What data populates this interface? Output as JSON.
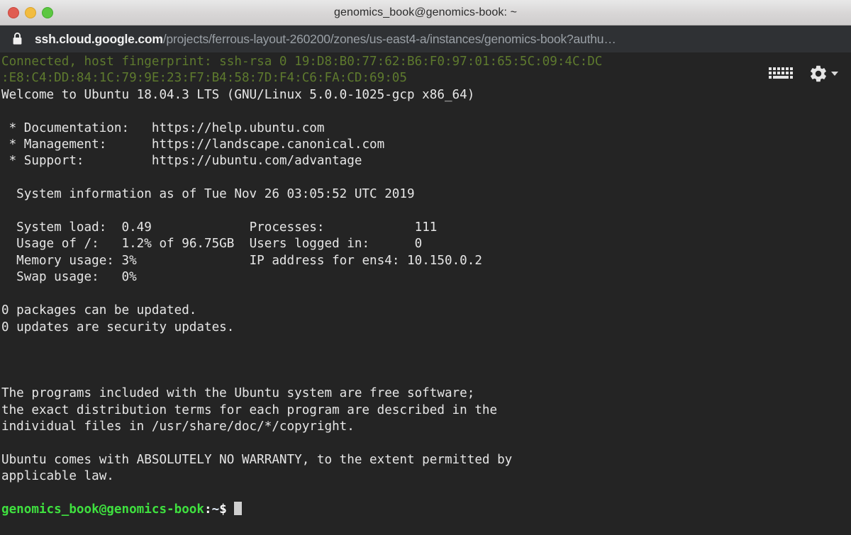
{
  "window": {
    "title": "genomics_book@genomics-book: ~",
    "controls": [
      {
        "name": "close",
        "color": "#e05c51"
      },
      {
        "name": "minimize",
        "color": "#f2bc3f"
      },
      {
        "name": "maximize",
        "color": "#5cc741"
      }
    ]
  },
  "urlbar": {
    "lock_icon": "lock-icon",
    "host": "ssh.cloud.google.com",
    "path": "/projects/ferrous-layout-260200/zones/us-east4-a/instances/genomics-book?authu…"
  },
  "toolbar": {
    "keyboard_icon": "keyboard-icon",
    "settings_icon": "gear-icon",
    "settings_caret_icon": "chevron-down-icon"
  },
  "terminal": {
    "colors": {
      "background": "#242424",
      "foreground": "#e6e6e6",
      "fingerprint_green": "#5e7a2e",
      "prompt_green": "#3fe03f",
      "cursor": "#cfcfcf"
    },
    "fingerprint_line_1": "Connected, host fingerprint: ssh-rsa 0 19:D8:B0:77:62:B6:F0:97:01:65:5C:09:4C:DC",
    "fingerprint_line_2": ":E8:C4:DD:84:1C:79:9E:23:F7:B4:58:7D:F4:C6:FA:CD:69:05",
    "welcome": "Welcome to Ubuntu 18.04.3 LTS (GNU/Linux 5.0.0-1025-gcp x86_64)",
    "links": [
      {
        "label": " * Documentation:",
        "url": "https://help.ubuntu.com"
      },
      {
        "label": " * Management:",
        "url": "https://landscape.canonical.com"
      },
      {
        "label": " * Support:",
        "url": "https://ubuntu.com/advantage"
      }
    ],
    "sysinfo_header": "  System information as of Tue Nov 26 03:05:52 UTC 2019",
    "sysinfo_rows": [
      {
        "left_label": "  System load:  ",
        "left_value": "0.49",
        "right_label": "Processes:            ",
        "right_value": "111"
      },
      {
        "left_label": "  Usage of /:   ",
        "left_value": "1.2% of 96.75GB",
        "right_label": "Users logged in:      ",
        "right_value": "0"
      },
      {
        "left_label": "  Memory usage: ",
        "left_value": "3%",
        "right_label": "IP address for ens4: ",
        "right_value": "10.150.0.2"
      },
      {
        "left_label": "  Swap usage:   ",
        "left_value": "0%",
        "right_label": "",
        "right_value": ""
      }
    ],
    "updates": [
      "0 packages can be updated.",
      "0 updates are security updates."
    ],
    "legal_paragraph_1": [
      "The programs included with the Ubuntu system are free software;",
      "the exact distribution terms for each program are described in the",
      "individual files in /usr/share/doc/*/copyright."
    ],
    "legal_paragraph_2": [
      "Ubuntu comes with ABSOLUTELY NO WARRANTY, to the extent permitted by",
      "applicable law."
    ],
    "prompt": {
      "user_host": "genomics_book@genomics-book",
      "colon": ":",
      "tilde": "~",
      "dollar": "$"
    }
  }
}
